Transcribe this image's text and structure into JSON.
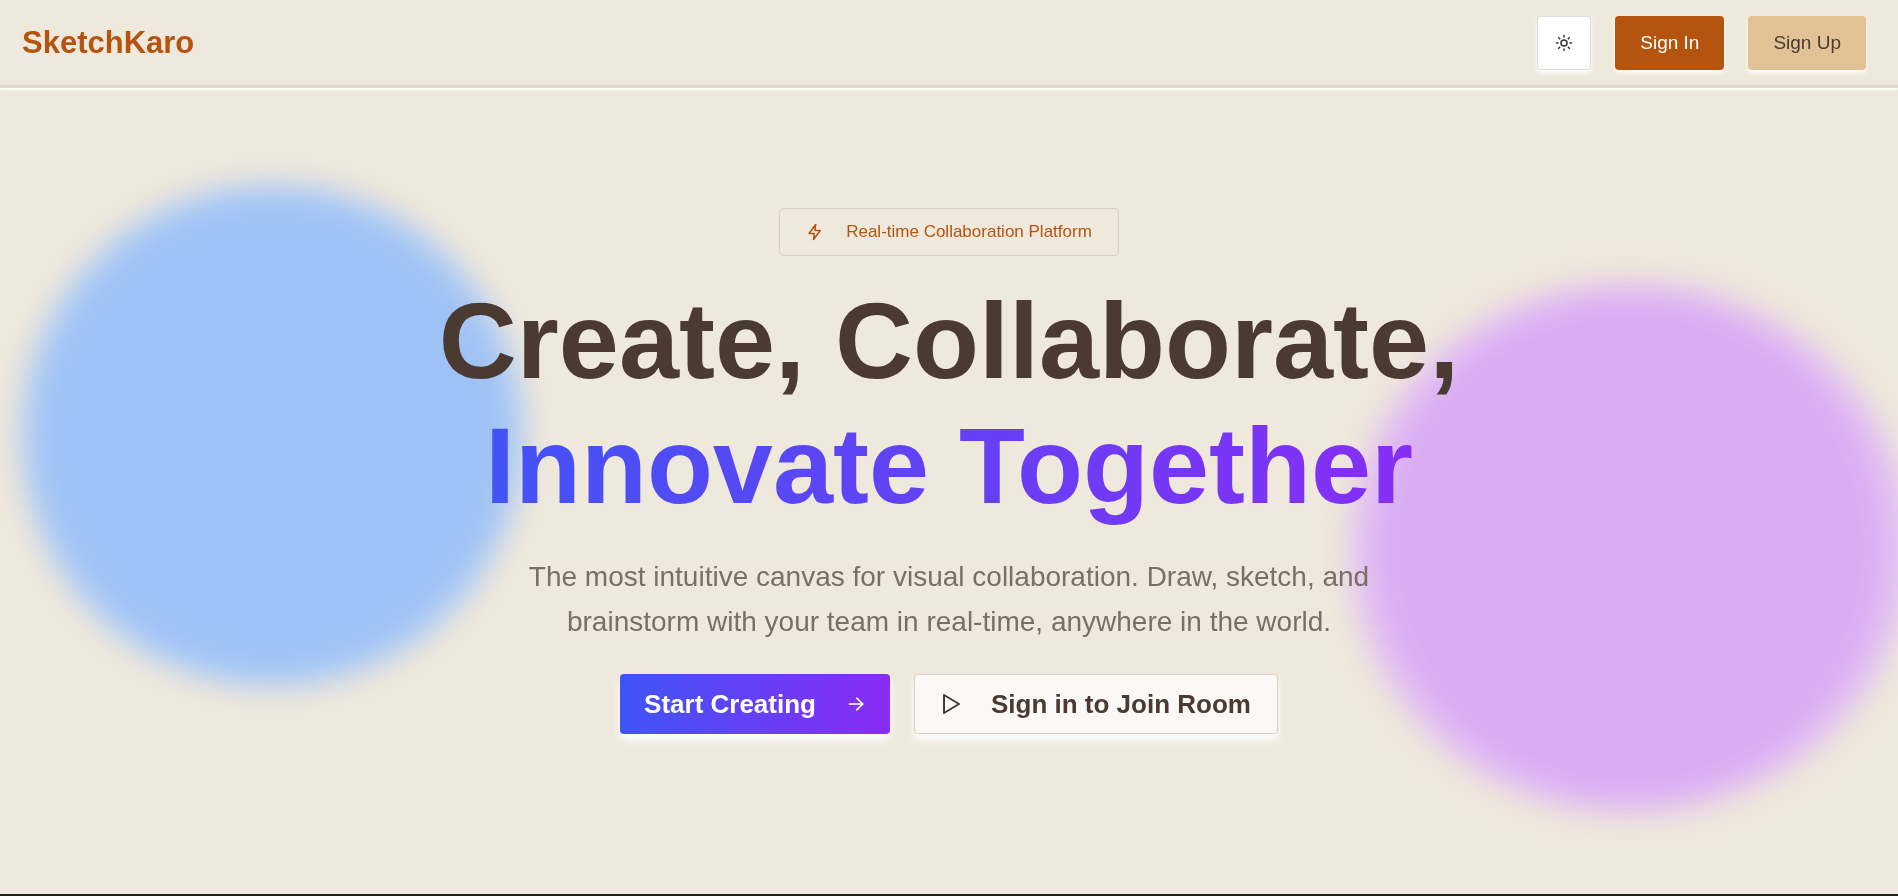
{
  "header": {
    "logo": "SketchKaro",
    "buttons": [
      {
        "kind": "theme"
      },
      {
        "kind": "primary",
        "label": "Sign In"
      },
      {
        "kind": "secondary",
        "label": "Sign Up"
      }
    ]
  },
  "hero": {
    "badge": "Real-time Collaboration Platform",
    "headline": "Create, Collaborate,",
    "headline_accent": "Innovate Together",
    "description": "The most intuitive canvas for visual collaboration. Draw, sketch, and brainstorm with your team in real-time, anywhere in the world.",
    "actions": [
      {
        "kind": "primary",
        "label": "Start Creating"
      },
      {
        "kind": "secondary",
        "label": "Sign in to Join Room"
      }
    ]
  }
}
